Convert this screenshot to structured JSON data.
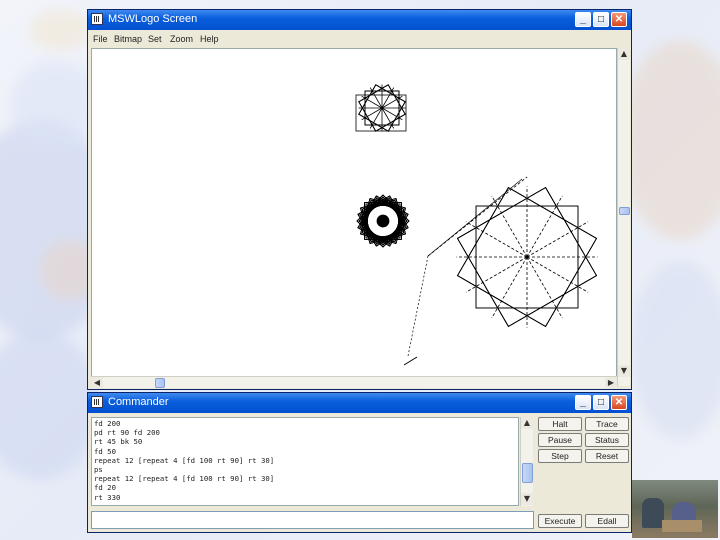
{
  "screen_window": {
    "title": "MSWLogo Screen",
    "menu": [
      "File",
      "Bitmap",
      "Set",
      "Zoom",
      "Help"
    ],
    "controls": {
      "minimize": "_",
      "maximize": "□",
      "close": "✕"
    }
  },
  "commander_window": {
    "title": "Commander",
    "controls": {
      "minimize": "_",
      "maximize": "□",
      "close": "✕"
    },
    "history": [
      "fd 200",
      "pd rt 90 fd 200",
      "rt 45 bk 50",
      "fd 50",
      "repeat 12 [repeat 4 [fd 100 rt 90] rt 30]",
      "ps",
      "repeat 12 [repeat 4 [fd 100 rt 90] rt 30]",
      "fd 20",
      "rt 330"
    ],
    "input_value": "",
    "buttons": {
      "halt": "Halt",
      "trace": "Trace",
      "pause": "Pause",
      "status": "Status",
      "step": "Step",
      "reset": "Reset",
      "execute": "Execute",
      "edall": "Edall"
    }
  },
  "icons": {
    "window_icon": "logo-window-icon",
    "scroll_up": "arrow-up-icon",
    "scroll_down": "arrow-down-icon",
    "scroll_left": "arrow-left-icon",
    "scroll_right": "arrow-right-icon"
  },
  "colors": {
    "titlebar": "#0350d0",
    "window_face": "#ece9d8",
    "canvas": "#ffffff",
    "ink": "#000000"
  }
}
